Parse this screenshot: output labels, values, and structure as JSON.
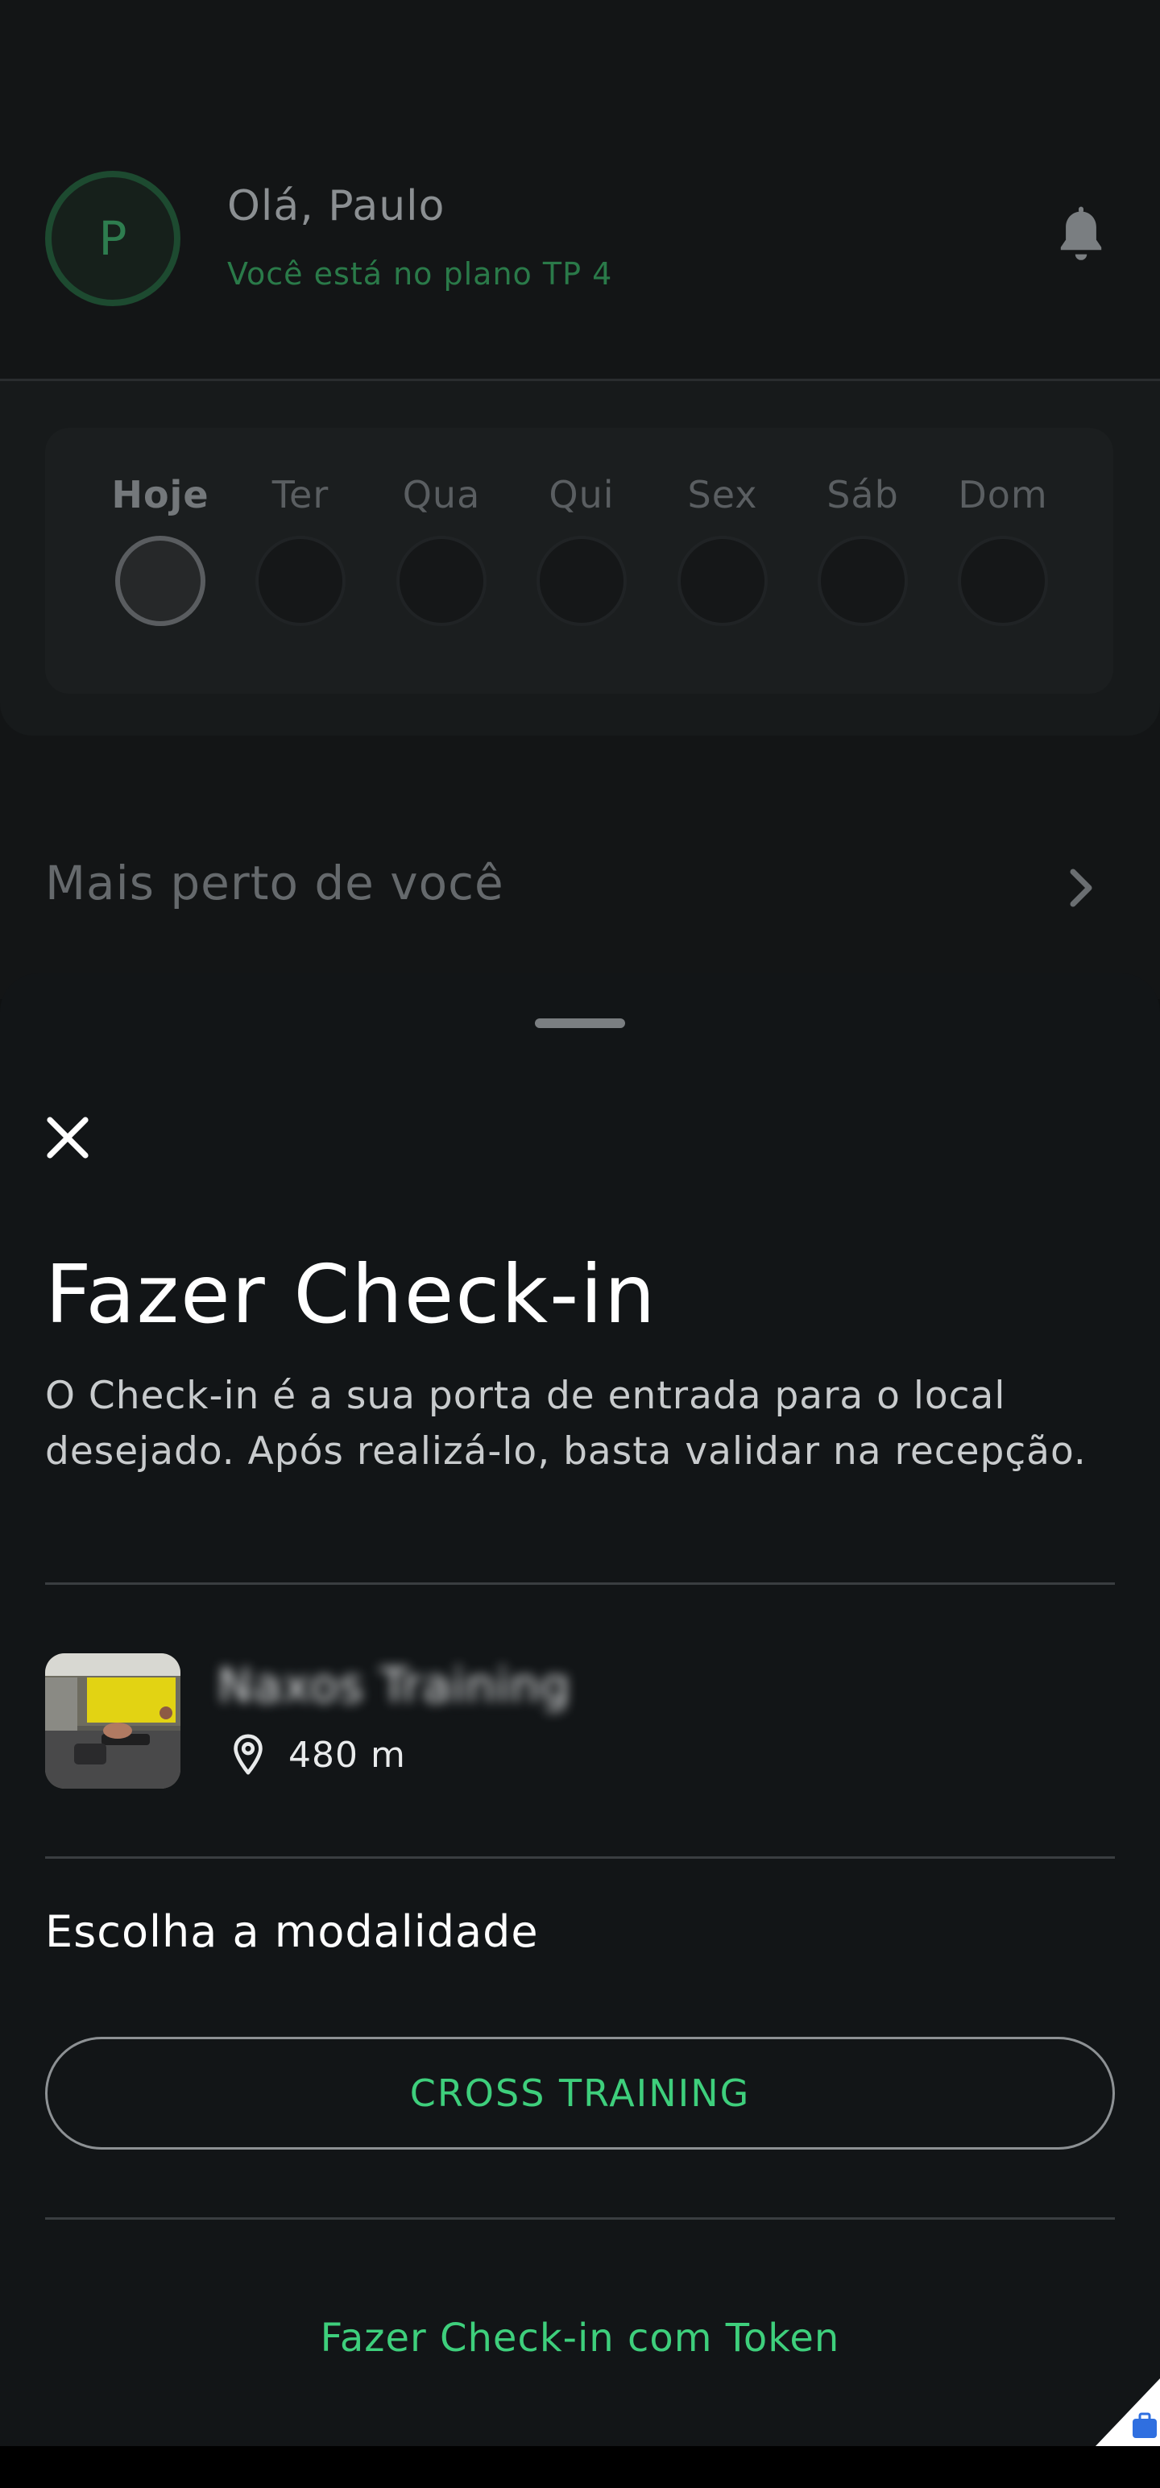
{
  "header": {
    "avatar_initial": "P",
    "greeting": "Olá, Paulo",
    "plan": "Você está no plano TP 4"
  },
  "week": {
    "days": [
      {
        "label": "Hoje",
        "today": true
      },
      {
        "label": "Ter",
        "today": false
      },
      {
        "label": "Qua",
        "today": false
      },
      {
        "label": "Qui",
        "today": false
      },
      {
        "label": "Sex",
        "today": false
      },
      {
        "label": "Sáb",
        "today": false
      },
      {
        "label": "Dom",
        "today": false
      }
    ]
  },
  "nearby": {
    "title": "Mais perto de você"
  },
  "checkin_sheet": {
    "title": "Fazer Check-in",
    "description": "O Check-in é a sua porta de entrada para o local desejado. Após realizá-lo, basta validar na recepção.",
    "gym": {
      "name": "Naxos Training",
      "distance": "480 m"
    },
    "modalidade_label": "Escolha a modalidade",
    "modalidade_option": "CROSS TRAINING",
    "token_link": "Fazer Check-in com Token"
  },
  "icons": {
    "close": "close-icon",
    "bell": "bell-icon",
    "chevron": "chevron-right-icon",
    "pin": "location-pin-icon"
  },
  "colors": {
    "accent": "#3ecf7c",
    "plan_green": "#2a7a49",
    "sheet_bg": "#121517"
  }
}
